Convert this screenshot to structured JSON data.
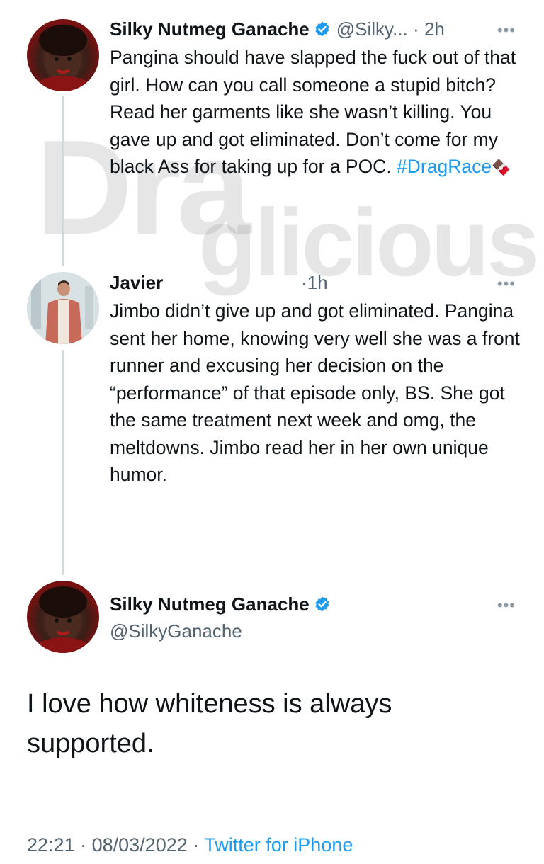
{
  "watermark": {
    "part1": "Dra",
    "part2": "glicious"
  },
  "tweet1": {
    "name": "Silky Nutmeg Ganache",
    "handle": "@Silky...",
    "sep": "·",
    "time": "2h",
    "more": "•••",
    "text_before": "Pangina should have slapped the fuck out of that girl. How can you call someone a stupid bitch?  Read her garments like she wasn’t killing. You gave up and got eliminated. Don’t come for my black Ass for taking up for a POC. ",
    "hashtag": "#DragRace",
    "emoji": "🍫"
  },
  "tweet2": {
    "name": "Javier",
    "sep": "·",
    "time": "1h",
    "more": "•••",
    "text": "Jimbo didn’t give up and got eliminated. Pangina sent her home, knowing very well she was a front runner and excusing her decision on the “performance” of that episode only, BS. She got the same treatment next week and omg, the meltdowns. Jimbo read her in her own unique humor."
  },
  "main_tweet": {
    "name": "Silky Nutmeg Ganache",
    "handle": "@SilkyGanache",
    "more": "•••",
    "text": "I love how whiteness is always supported.",
    "time": "22:21",
    "sep1": "·",
    "date": "08/03/2022",
    "sep2": "·",
    "source": "Twitter for iPhone"
  },
  "colors": {
    "link": "#1d9bf0",
    "secondary": "#536471",
    "verified": "#1d9bf0"
  }
}
